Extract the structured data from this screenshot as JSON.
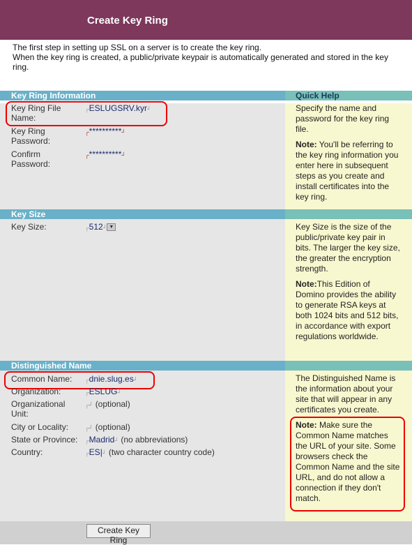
{
  "header": {
    "title": "Create Key Ring"
  },
  "intro": {
    "line1": "The first step in setting up SSL on a server is to create the key ring.",
    "line2": "When the key ring is created, a public/private keypair is automatically generated and stored in the key ring."
  },
  "key_ring_info": {
    "heading": "Key Ring Information",
    "file_label": "Key Ring File Name:",
    "file_value": "ESLUGSRV.kyr",
    "password_label": "Key Ring Password:",
    "password_value": "**********",
    "confirm_label": "Confirm Password:",
    "confirm_value": "**********"
  },
  "quick_help": {
    "heading": "Quick Help",
    "p1": "Specify the name and password for the key ring file.",
    "note1_label": "Note:",
    "note1": " You'll be referring to the key ring information you enter here in subsequent steps as you create and install certificates into the key ring.",
    "p2": "Key Size is the size of the public/private key pair in bits.   The larger the key size, the greater the encryption strength.",
    "note2_label": "Note:",
    "note2": "This Edition of Domino provides the ability to generate RSA keys at both 1024 bits and 512 bits, in accordance with export regulations worldwide.",
    "p3": "The Distinguished Name is the information about your site that will appear in any certificates you create.",
    "note3_label": "Note:",
    "note3": " Make sure the Common Name matches the URL of your site. Some browsers check the Common Name and the site URL, and do not allow a connection if they don't match."
  },
  "key_size": {
    "heading": "Key Size",
    "label": "Key Size:",
    "value": "512"
  },
  "dn": {
    "heading": "Distinguished Name",
    "cn_label": "Common Name:",
    "cn_value": "dnie.slug.es",
    "org_label": "Organization:",
    "org_value": "ESLUG",
    "ou_label": "Organizational Unit:",
    "ou_value": "",
    "ou_hint": "(optional)",
    "city_label": "City or Locality:",
    "city_value": "",
    "city_hint": "(optional)",
    "state_label": "State or Province:",
    "state_value": "Madrid",
    "state_hint": "(no abbreviations)",
    "country_label": "Country:",
    "country_value": "ES",
    "country_hint": "(two character country code)"
  },
  "footer": {
    "button": "Create Key Ring"
  },
  "colors": {
    "header": "#7d385c",
    "section": "#6ab0c8",
    "quick_help": "#78c0b8",
    "help_bg": "#f8f8d0",
    "highlight": "#ee0000"
  }
}
